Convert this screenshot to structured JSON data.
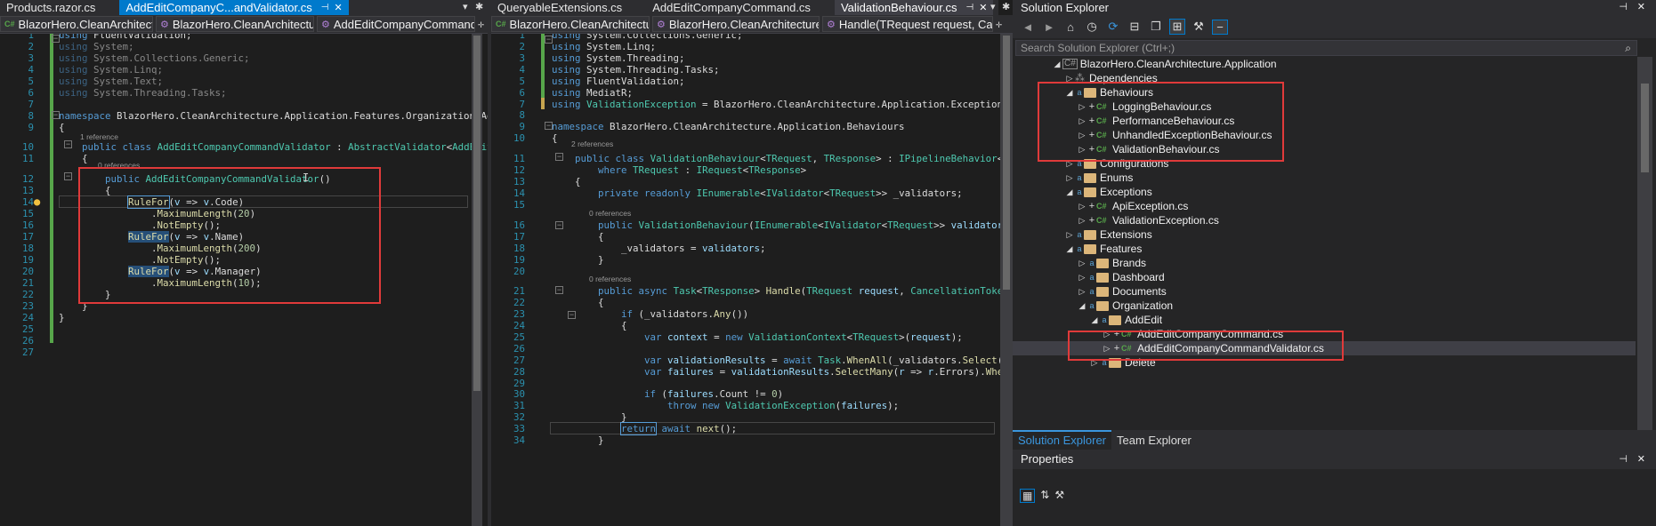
{
  "left_pane": {
    "tabs": [
      {
        "label": "Products.razor.cs",
        "active": false
      },
      {
        "label": "AddEditCompanyC...andValidator.cs",
        "active": true
      }
    ],
    "nav": [
      "BlazorHero.CleanArchitecture.",
      "BlazorHero.CleanArchitecture.",
      "AddEditCompanyCommandVa"
    ],
    "lines": [
      {
        "n": "1",
        "html": "<span class=\"k\">using</span> FluentValidation;"
      },
      {
        "n": "2",
        "html": "<span class=\"k\" style=\"opacity:.55\">using</span><span style=\"opacity:.55\"> System;</span>"
      },
      {
        "n": "3",
        "html": "<span class=\"k\" style=\"opacity:.55\">using</span><span style=\"opacity:.55\"> System.Collections.Generic;</span>"
      },
      {
        "n": "4",
        "html": "<span class=\"k\" style=\"opacity:.55\">using</span><span style=\"opacity:.55\"> System.Linq;</span>"
      },
      {
        "n": "5",
        "html": "<span class=\"k\" style=\"opacity:.55\">using</span><span style=\"opacity:.55\"> System.Text;</span>"
      },
      {
        "n": "6",
        "html": "<span class=\"k\" style=\"opacity:.55\">using</span><span style=\"opacity:.55\"> System.Threading.Tasks;</span>"
      },
      {
        "n": "7",
        "html": ""
      },
      {
        "n": "8",
        "html": "<span class=\"k\">namespace</span> BlazorHero.CleanArchitecture.Application.Features.Organization.AddEdit"
      },
      {
        "n": "9",
        "html": "{"
      },
      {
        "n": "10",
        "html": "    <span class=\"k\">public</span> <span class=\"k\">class</span> <span class=\"t\">AddEditCompanyCommandValidator</span> : <span class=\"t\">AbstractValidator</span>&lt;<span class=\"t\">AddEditCompanyCommand</span>&gt;"
      },
      {
        "n": "11",
        "html": "    {"
      },
      {
        "n": "12",
        "html": "        <span class=\"k\">public</span> <span class=\"t\">AddEditCompanyCommandValidator</span>()"
      },
      {
        "n": "13",
        "html": "        {"
      },
      {
        "n": "14",
        "html": "            <span class=\"m\" style=\"outline:1px solid #569cd6\">RuleFor</span>(<span class=\"p\">v</span> =&gt; <span class=\"p\">v</span>.Code)"
      },
      {
        "n": "15",
        "html": "                .<span class=\"m\">MaximumLength</span>(<span class=\"n\">20</span>)"
      },
      {
        "n": "16",
        "html": "                .<span class=\"m\">NotEmpty</span>();"
      },
      {
        "n": "17",
        "html": "            <span class=\"m\" style=\"background:#264f78\">RuleFor</span>(<span class=\"p\">v</span> =&gt; <span class=\"p\">v</span>.Name)"
      },
      {
        "n": "18",
        "html": "                .<span class=\"m\">MaximumLength</span>(<span class=\"n\">200</span>)"
      },
      {
        "n": "19",
        "html": "                .<span class=\"m\">NotEmpty</span>();"
      },
      {
        "n": "20",
        "html": "            <span class=\"m\" style=\"background:#264f78\">RuleFor</span>(<span class=\"p\">v</span> =&gt; <span class=\"p\">v</span>.Manager)"
      },
      {
        "n": "21",
        "html": "                .<span class=\"m\">MaximumLength</span>(<span class=\"n\">10</span>);"
      },
      {
        "n": "22",
        "html": "        }"
      },
      {
        "n": "23",
        "html": "    }"
      },
      {
        "n": "24",
        "html": "}"
      },
      {
        "n": "25",
        "html": ""
      },
      {
        "n": "26",
        "html": ""
      },
      {
        "n": "27",
        "html": ""
      }
    ],
    "refs": [
      "1 reference",
      "0 references"
    ]
  },
  "mid_pane": {
    "tabs": [
      {
        "label": "QueryableExtensions.cs",
        "active": false
      },
      {
        "label": "AddEditCompanyCommand.cs",
        "active": false
      },
      {
        "label": "ValidationBehaviour.cs",
        "active": true
      }
    ],
    "nav": [
      "BlazorHero.CleanArchitecture.Ap",
      "BlazorHero.CleanArchitecture.Ap",
      "Handle(TRequest request, Cance"
    ],
    "lines": [
      {
        "n": "1",
        "html": "<span class=\"k\">using</span> System.Collections.Generic;"
      },
      {
        "n": "2",
        "html": "<span class=\"k\">using</span> System.Linq;"
      },
      {
        "n": "3",
        "html": "<span class=\"k\">using</span> System.Threading;"
      },
      {
        "n": "4",
        "html": "<span class=\"k\">using</span> System.Threading.Tasks;"
      },
      {
        "n": "5",
        "html": "<span class=\"k\">using</span> FluentValidation;"
      },
      {
        "n": "6",
        "html": "<span class=\"k\">using</span> MediatR;"
      },
      {
        "n": "7",
        "html": "<span class=\"k\">using</span> <span class=\"t\">ValidationException</span> = BlazorHero.CleanArchitecture.Application.Exceptions.<span class=\"t\">ValidationExc</span>"
      },
      {
        "n": "8",
        "html": ""
      },
      {
        "n": "9",
        "html": "<span class=\"k\">namespace</span> BlazorHero.CleanArchitecture.Application.Behaviours"
      },
      {
        "n": "10",
        "html": "{"
      },
      {
        "n": "11",
        "html": "    <span class=\"k\">public</span> <span class=\"k\">class</span> <span class=\"t\">ValidationBehaviour</span>&lt;<span class=\"t\">TRequest</span>, <span class=\"t\">TResponse</span>&gt; : <span class=\"t\">IPipelineBehavior</span>&lt;<span class=\"t\">TRequest</span>, <span class=\"t\">TResp</span>"
      },
      {
        "n": "12",
        "html": "        <span class=\"k\">where</span> <span class=\"t\">TRequest</span> : <span class=\"t\">IRequest</span>&lt;<span class=\"t\">TResponse</span>&gt;"
      },
      {
        "n": "13",
        "html": "    {"
      },
      {
        "n": "14",
        "html": "        <span class=\"k\">private</span> <span class=\"k\">readonly</span> <span class=\"t\">IEnumerable</span>&lt;<span class=\"t\">IValidator</span>&lt;<span class=\"t\">TRequest</span>&gt;&gt; _validators;"
      },
      {
        "n": "15",
        "html": ""
      },
      {
        "n": "16",
        "html": "        <span class=\"k\">public</span> <span class=\"t\">ValidationBehaviour</span>(<span class=\"t\">IEnumerable</span>&lt;<span class=\"t\">IValidator</span>&lt;<span class=\"t\">TRequest</span>&gt;&gt; <span class=\"p\">validators</span>)"
      },
      {
        "n": "17",
        "html": "        {"
      },
      {
        "n": "18",
        "html": "            _validators = <span class=\"p\">validators</span>;"
      },
      {
        "n": "19",
        "html": "        }"
      },
      {
        "n": "20",
        "html": ""
      },
      {
        "n": "21",
        "html": "        <span class=\"k\">public</span> <span class=\"k\">async</span> <span class=\"t\">Task</span>&lt;<span class=\"t\">TResponse</span>&gt; <span class=\"m\">Handle</span>(<span class=\"t\">TRequest</span> <span class=\"p\">request</span>, <span class=\"t\">CancellationToken</span> <span class=\"p\">cancellationT</span>"
      },
      {
        "n": "22",
        "html": "        {"
      },
      {
        "n": "23",
        "html": "            <span class=\"k\">if</span> (_validators.<span class=\"m\">Any</span>())"
      },
      {
        "n": "24",
        "html": "            {"
      },
      {
        "n": "25",
        "html": "                <span class=\"k\">var</span> <span class=\"p\">context</span> = <span class=\"k\">new</span> <span class=\"t\">ValidationContext</span>&lt;<span class=\"t\">TRequest</span>&gt;(<span class=\"p\">request</span>);"
      },
      {
        "n": "26",
        "html": ""
      },
      {
        "n": "27",
        "html": "                <span class=\"k\">var</span> <span class=\"p\">validationResults</span> = <span class=\"k\">await</span> <span class=\"t\">Task</span>.<span class=\"m\">WhenAll</span>(_validators.<span class=\"m\">Select</span>(<span class=\"p\">v</span> =&gt; <span class=\"p\">v</span>.<span class=\"m\">Validate</span>"
      },
      {
        "n": "28",
        "html": "                <span class=\"k\">var</span> <span class=\"p\">failures</span> = <span class=\"p\">validationResults</span>.<span class=\"m\">SelectMany</span>(<span class=\"p\">r</span> =&gt; <span class=\"p\">r</span>.Errors).<span class=\"m\">Where</span>(<span class=\"p\">f</span> =&gt; <span class=\"p\">f</span> != <span class=\"k\">nu</span>"
      },
      {
        "n": "29",
        "html": ""
      },
      {
        "n": "30",
        "html": "                <span class=\"k\">if</span> (<span class=\"p\">failures</span>.Count != <span class=\"n\">0</span>)"
      },
      {
        "n": "31",
        "html": "                    <span class=\"k\">throw</span> <span class=\"k\">new</span> <span class=\"t\">ValidationException</span>(<span class=\"p\">failures</span>);"
      },
      {
        "n": "32",
        "html": "            }"
      },
      {
        "n": "33",
        "html": "            <span class=\"k\" style=\"outline:1px solid #569cd6\">return</span> <span class=\"k\">await</span> <span class=\"m\">next</span>();"
      },
      {
        "n": "34",
        "html": "        }"
      }
    ],
    "refs": [
      "2 references",
      "0 references",
      "0 references"
    ]
  },
  "solution_explorer": {
    "title": "Solution Explorer",
    "search_placeholder": "Search Solution Explorer (Ctrl+;)",
    "tree": [
      {
        "label": "BlazorHero.CleanArchitecture.Application",
        "kind": "project"
      },
      {
        "label": "Dependencies",
        "kind": "dep"
      },
      {
        "label": "Behaviours",
        "kind": "folder-open"
      },
      {
        "label": "LoggingBehaviour.cs",
        "kind": "cs"
      },
      {
        "label": "PerformanceBehaviour.cs",
        "kind": "cs"
      },
      {
        "label": "UnhandledExceptionBehaviour.cs",
        "kind": "cs"
      },
      {
        "label": "ValidationBehaviour.cs",
        "kind": "cs"
      },
      {
        "label": "Configurations",
        "kind": "folder"
      },
      {
        "label": "Enums",
        "kind": "folder"
      },
      {
        "label": "Exceptions",
        "kind": "folder-open"
      },
      {
        "label": "ApiException.cs",
        "kind": "cs"
      },
      {
        "label": "ValidationException.cs",
        "kind": "cs"
      },
      {
        "label": "Extensions",
        "kind": "folder"
      },
      {
        "label": "Features",
        "kind": "folder-open"
      },
      {
        "label": "Brands",
        "kind": "folder"
      },
      {
        "label": "Dashboard",
        "kind": "folder"
      },
      {
        "label": "Documents",
        "kind": "folder"
      },
      {
        "label": "Organization",
        "kind": "folder-open"
      },
      {
        "label": "AddEdit",
        "kind": "folder-open"
      },
      {
        "label": "AddEditCompanyCommand.cs",
        "kind": "cs"
      },
      {
        "label": "AddEditCompanyCommandValidator.cs",
        "kind": "cs"
      },
      {
        "label": "Delete",
        "kind": "folder"
      }
    ],
    "bottom_tabs": [
      "Solution Explorer",
      "Team Explorer"
    ],
    "properties_title": "Properties"
  },
  "colors": {
    "highlight_box": "#e03a3a",
    "accent": "#007acc"
  }
}
